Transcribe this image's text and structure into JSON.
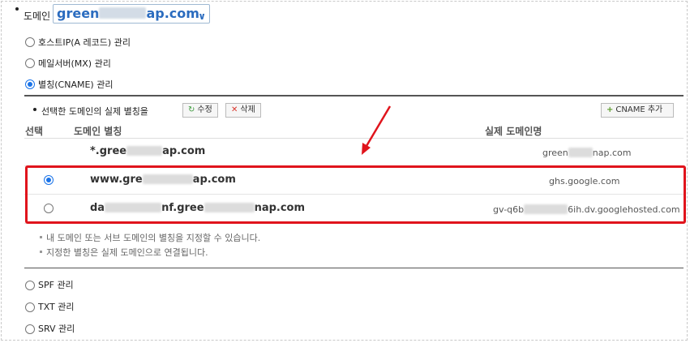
{
  "domain": {
    "label": "도메인",
    "selected_prefix": "green",
    "selected_suffix": "ap.com"
  },
  "options": [
    {
      "label": "호스트IP(A 레코드) 관리",
      "checked": false
    },
    {
      "label": "메일서버(MX) 관리",
      "checked": false
    },
    {
      "label": "별칭(CNAME) 관리",
      "checked": true
    }
  ],
  "cname": {
    "instruction": "선택한 도메인의 실제 별칭을",
    "edit_label": "수정",
    "delete_label": "삭제",
    "add_label": "CNAME 추가",
    "columns": {
      "select": "선택",
      "alias": "도메인 별칭",
      "real": "실제 도메인명"
    },
    "rows": [
      {
        "alias_prefix": "*.gree",
        "alias_suffix": "ap.com",
        "real_prefix": "green",
        "real_suffix": "nap.com",
        "selectable": false,
        "checked": false
      },
      {
        "alias_prefix": "www.gre",
        "alias_suffix": "ap.com",
        "real_prefix": "ghs.google.com",
        "real_suffix": "",
        "selectable": true,
        "checked": true
      },
      {
        "alias_prefix": "da",
        "alias_mid": "nf.gree",
        "alias_suffix": "nap.com",
        "real_prefix": "gv-q6b",
        "real_suffix": "6ih.dv.googlehosted.com",
        "selectable": true,
        "checked": false
      }
    ],
    "notes": [
      "내 도메인 또는 서브 도메인의 별칭을 지정할 수 있습니다.",
      "지정한 별칭은 실제 도메인으로 연결됩니다."
    ]
  },
  "other_options": [
    {
      "label": "SPF 관리",
      "checked": false
    },
    {
      "label": "TXT 관리",
      "checked": false
    },
    {
      "label": "SRV 관리",
      "checked": false
    }
  ],
  "colors": {
    "highlight": "#e0141c",
    "accent": "#1a73e8",
    "domain_text": "#2b6cbf"
  }
}
